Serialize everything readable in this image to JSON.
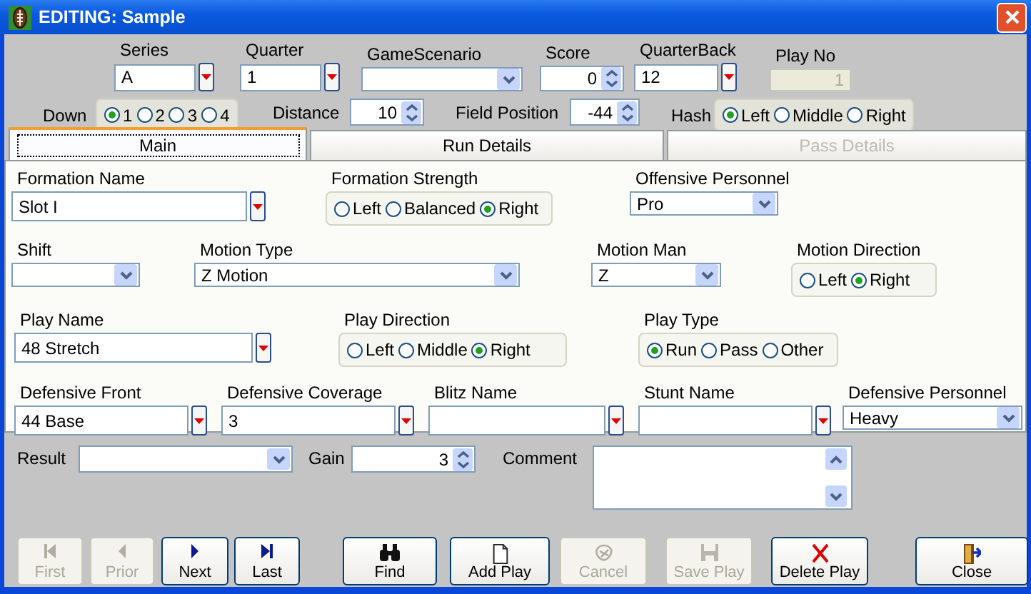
{
  "window": {
    "title": "EDITING: Sample"
  },
  "header": [
    [
      {
        "label": "Series",
        "kind": "picklist",
        "value": "A"
      },
      {
        "label": "Quarter",
        "kind": "picklist",
        "value": "1"
      },
      {
        "label": "GameScenario",
        "kind": "dropdown"
      },
      {
        "label": "Score",
        "kind": "spinner",
        "value": "0"
      },
      {
        "label": "QuarterBack",
        "kind": "picklist",
        "value": "12"
      },
      {
        "label": "Play No",
        "kind": "readonly",
        "value": "1"
      }
    ],
    [
      {
        "label": "Down",
        "kind": "radio",
        "options": [
          {
            "label": "1",
            "selected": true
          },
          {
            "label": "2",
            "selected": false
          },
          {
            "label": "3",
            "selected": false
          },
          {
            "label": "4",
            "selected": false
          }
        ]
      },
      {
        "label": "Distance",
        "kind": "spinner",
        "value": "10"
      },
      {
        "label": "Field Position",
        "kind": "spinner",
        "value": "-44"
      },
      {
        "label": "Hash",
        "kind": "radio",
        "options": [
          {
            "label": "Left",
            "selected": true
          },
          {
            "label": "Middle",
            "selected": false
          },
          {
            "label": "Right",
            "selected": false
          }
        ]
      }
    ]
  ],
  "tabs": [
    {
      "label": "Main",
      "selected": true,
      "disabled": false
    },
    {
      "label": "Run Details",
      "selected": false,
      "disabled": false
    },
    {
      "label": "Pass Details",
      "selected": false,
      "disabled": true
    }
  ],
  "main_tab": [
    [
      {
        "label": "Formation Name",
        "kind": "picklist",
        "value": "Slot I"
      },
      {
        "label": "Formation Strength",
        "kind": "radio",
        "options": [
          {
            "label": "Left",
            "selected": false
          },
          {
            "label": "Balanced",
            "selected": false
          },
          {
            "label": "Right",
            "selected": true
          }
        ]
      },
      {
        "label": "Offensive Personnel",
        "kind": "dropdown",
        "value": "Pro"
      }
    ],
    [
      {
        "label": "Shift",
        "kind": "dropdown"
      },
      {
        "label": "Motion Type",
        "kind": "dropdown",
        "value": "Z Motion"
      },
      {
        "label": "Motion Man",
        "kind": "dropdown",
        "value": "Z"
      },
      {
        "label": "Motion Direction",
        "kind": "radio",
        "options": [
          {
            "label": "Left",
            "selected": false
          },
          {
            "label": "Right",
            "selected": true
          }
        ]
      }
    ],
    [
      {
        "label": "Play Name",
        "kind": "picklist",
        "value": "48 Stretch"
      },
      {
        "label": "Play Direction",
        "kind": "radio",
        "options": [
          {
            "label": "Left",
            "selected": false
          },
          {
            "label": "Middle",
            "selected": false
          },
          {
            "label": "Right",
            "selected": true
          }
        ]
      },
      {
        "label": "Play Type",
        "kind": "radio",
        "options": [
          {
            "label": "Run",
            "selected": true
          },
          {
            "label": "Pass",
            "selected": false
          },
          {
            "label": "Other",
            "selected": false
          }
        ]
      }
    ],
    [
      {
        "label": "Defensive Front",
        "kind": "picklist",
        "value": "44 Base"
      },
      {
        "label": "Defensive Coverage",
        "kind": "picklist",
        "value": "3"
      },
      {
        "label": "Blitz Name",
        "kind": "picklist"
      },
      {
        "label": "Stunt Name",
        "kind": "picklist"
      },
      {
        "label": "Defensive Personnel",
        "kind": "dropdown",
        "value": "Heavy"
      }
    ]
  ],
  "footer_fields": [
    [
      {
        "label": "Result",
        "kind": "dropdown"
      },
      {
        "label": "Gain",
        "kind": "spinner",
        "value": "3"
      },
      {
        "label": "Comment",
        "kind": "memo"
      }
    ]
  ],
  "buttons": [
    {
      "label": "First",
      "kind": "first",
      "disabled": true
    },
    {
      "label": "Prior",
      "kind": "prior",
      "disabled": true
    },
    {
      "label": "Next",
      "kind": "next",
      "disabled": false
    },
    {
      "label": "Last",
      "kind": "last",
      "disabled": false
    },
    {
      "label": "Find",
      "kind": "find",
      "disabled": false
    },
    {
      "label": "Add Play",
      "kind": "add",
      "disabled": false
    },
    {
      "label": "Cancel",
      "kind": "cancel",
      "disabled": true
    },
    {
      "label": "Save Play",
      "kind": "save",
      "disabled": true
    },
    {
      "label": "Delete Play",
      "kind": "delete",
      "disabled": false
    },
    {
      "label": "Close",
      "kind": "close",
      "disabled": false
    }
  ]
}
